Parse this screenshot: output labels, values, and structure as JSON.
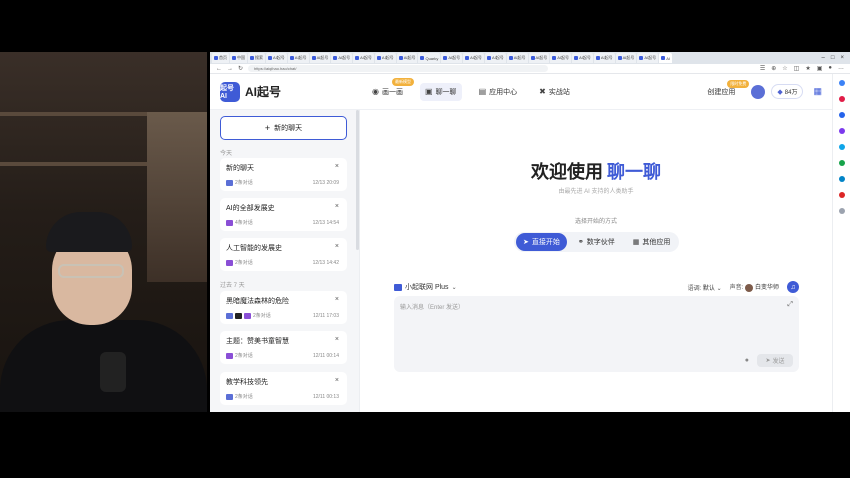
{
  "browser": {
    "tabs": [
      "首页",
      "中国",
      "搜索",
      "AI起号",
      "AI起号",
      "AI起号",
      "AI起号",
      "AI起号",
      "AI起号",
      "AI起号",
      "Quarky",
      "AI起号",
      "AI起号",
      "AI起号",
      "AI起号",
      "AI起号",
      "AI起号",
      "AI起号",
      "AI起号",
      "AI起号",
      "AI起号",
      "AI"
    ],
    "url": "https://aiqihao.hao/chat/"
  },
  "header": {
    "logo_text": "起号AI",
    "app_name": "AI起号",
    "nav": [
      {
        "label": "画一画",
        "icon": "palette-icon",
        "tag": "最新模型"
      },
      {
        "label": "聊一聊",
        "icon": "chat-icon",
        "active": true
      },
      {
        "label": "应用中心",
        "icon": "apps-icon"
      },
      {
        "label": "实战站",
        "icon": "tools-icon"
      }
    ],
    "create_app": "创建应用",
    "create_tag": "限时免费",
    "points": "84万"
  },
  "sidebar": {
    "new_chat": "新的聊天",
    "today_label": "今天",
    "past_label": "过去 7 天",
    "chats": [
      {
        "title": "新的聊天",
        "count": "2条对话",
        "time": "12/13 20:09"
      },
      {
        "title": "AI的全部发展史",
        "count": "4条对话",
        "time": "12/13 14:54"
      },
      {
        "title": "人工智能的发展史",
        "count": "2条对话",
        "time": "12/13 14:42"
      },
      {
        "title": "黑暗魔法森林的危险",
        "count": "2条对话",
        "time": "12/11 17:03"
      },
      {
        "title": "主题：赞美书童智慧",
        "count": "2条对话",
        "time": "12/11 00:14"
      },
      {
        "title": "教学科技领先",
        "count": "2条对话",
        "time": "12/11 00:13"
      }
    ]
  },
  "main": {
    "welcome": "欢迎使用",
    "welcome_highlight": "聊一聊",
    "subtitle": "由最先进 AI 支持的人类助手",
    "mode_label": "选择开始的方式",
    "modes": [
      {
        "label": "直接开始",
        "icon": "send-icon",
        "active": true
      },
      {
        "label": "数字伙伴",
        "icon": "digital-partner-icon"
      },
      {
        "label": "其他应用",
        "icon": "grid-icon"
      }
    ],
    "model": "小起联网 Plus",
    "tone_label": "语调:",
    "tone_value": "默认",
    "voice_label": "声音:",
    "voice_value": "白变华师",
    "input_placeholder": "输入消息（Enter 发送）",
    "send": "发送"
  },
  "colors": {
    "accent": "#3f5bd6",
    "tag": "#f2b13c"
  }
}
